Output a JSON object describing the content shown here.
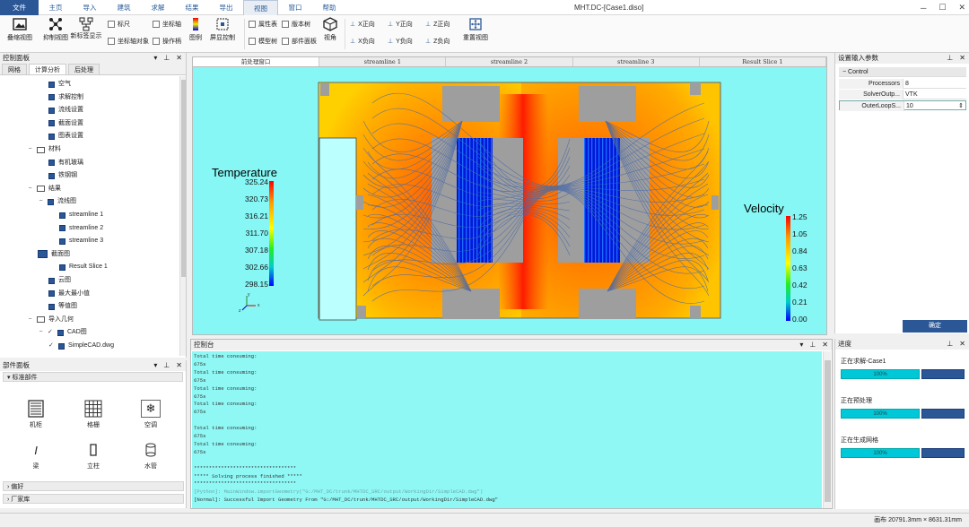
{
  "menu": {
    "items": [
      "文件",
      "主页",
      "导入",
      "建筑",
      "求解",
      "结果",
      "导出",
      "视图",
      "窗口",
      "帮助"
    ],
    "active_index": 7,
    "window_title": "MHT.DC-[Case1.diso]"
  },
  "toolbar": {
    "btn_overlay": "叠缩视图",
    "btn_shrink": "抑制视图",
    "btn_new_coord": "新标签显示",
    "chk_ruler": "标尺",
    "chk_coord_obj": "坐标轴对象",
    "chk_axis": "坐标轴",
    "chk_manipulator": "操作柄",
    "btn_legend": "图例",
    "btn_screen_ctrl": "屏显控制",
    "chk_props": "属性表",
    "chk_model_tree": "模型树",
    "chk_version_tree": "版本树",
    "chk_part_panel": "部件面板",
    "btn_view": "视角",
    "dir_xpos": "X正向",
    "dir_xneg": "X负向",
    "dir_ypos": "Y正向",
    "dir_yneg": "Y负向",
    "dir_zpos": "Z正向",
    "dir_zneg": "Z负向",
    "btn_reset": "重置视图"
  },
  "control_panel": {
    "title": "控制面板",
    "tabs": [
      "网格",
      "计算分析",
      "后处理"
    ],
    "active_tab": 1,
    "tree": [
      {
        "label": "空气",
        "level": 3,
        "icon": "box"
      },
      {
        "label": "求解控制",
        "level": 3,
        "icon": "box"
      },
      {
        "label": "流线设置",
        "level": 3,
        "icon": "box"
      },
      {
        "label": "截面设置",
        "level": 3,
        "icon": "box"
      },
      {
        "label": "图表设置",
        "level": 3,
        "icon": "box"
      },
      {
        "label": "材料",
        "level": 1,
        "icon": "folder"
      },
      {
        "label": "有机玻璃",
        "level": 3,
        "icon": "box"
      },
      {
        "label": "铁钢钢",
        "level": 3,
        "icon": "box"
      },
      {
        "label": "结果",
        "level": 1,
        "icon": "folder"
      },
      {
        "label": "流线图",
        "level": 2,
        "icon": "box"
      },
      {
        "label": "streamline 1",
        "level": 4,
        "icon": "box"
      },
      {
        "label": "streamline 2",
        "level": 4,
        "icon": "box"
      },
      {
        "label": "streamline 3",
        "level": 4,
        "icon": "box"
      },
      {
        "label": "截面图",
        "level": 2,
        "icon": "blue"
      },
      {
        "label": "Result Slice 1",
        "level": 4,
        "icon": "box"
      },
      {
        "label": "云图",
        "level": 3,
        "icon": "box"
      },
      {
        "label": "最大最小值",
        "level": 3,
        "icon": "box"
      },
      {
        "label": "等值图",
        "level": 3,
        "icon": "box"
      },
      {
        "label": "导入几何",
        "level": 1,
        "icon": "folder"
      },
      {
        "label": "CAD图",
        "level": 2,
        "icon": "check"
      },
      {
        "label": "SimpleCAD.dwg",
        "level": 3,
        "icon": "check"
      }
    ]
  },
  "parts_panel": {
    "title": "部件面板",
    "group": "标准部件",
    "items": [
      "机柜",
      "格栅",
      "空调",
      "梁",
      "立柱",
      "水管"
    ],
    "collapsed_groups": [
      "偏好",
      "厂家库"
    ]
  },
  "viewport": {
    "tabs": [
      "前处理窗口",
      "streamline 1",
      "streamline 2",
      "streamline 3",
      "Result Slice 1"
    ],
    "active_tab": 0,
    "temperature_legend": {
      "title": "Temperature",
      "ticks": [
        "325.24",
        "320.73",
        "316.21",
        "311.70",
        "307.18",
        "302.66",
        "298.15"
      ]
    },
    "velocity_legend": {
      "title": "Velocity",
      "ticks": [
        "1.25",
        "1.05",
        "0.84",
        "0.63",
        "0.42",
        "0.21",
        "0.00"
      ]
    },
    "axis_labels": {
      "x": "x",
      "y": "y",
      "z": "z"
    }
  },
  "console": {
    "title": "控制台",
    "lines": [
      {
        "text": "Total time consuming:",
        "type": "normal"
      },
      {
        "text": "675s",
        "type": "normal"
      },
      {
        "text": "Total time consuming:",
        "type": "normal"
      },
      {
        "text": "675s",
        "type": "normal"
      },
      {
        "text": "Total time consuming:",
        "type": "normal"
      },
      {
        "text": "675s",
        "type": "normal"
      },
      {
        "text": "Total time consuming:",
        "type": "normal"
      },
      {
        "text": "675s",
        "type": "normal"
      },
      {
        "text": "",
        "type": "normal"
      },
      {
        "text": "Total time consuming:",
        "type": "normal"
      },
      {
        "text": "675s",
        "type": "normal"
      },
      {
        "text": "Total time consuming:",
        "type": "normal"
      },
      {
        "text": "675s",
        "type": "normal"
      },
      {
        "text": "",
        "type": "normal"
      },
      {
        "text": "**********************************",
        "type": "normal"
      },
      {
        "text": "***** Solving process finished *****",
        "type": "normal"
      },
      {
        "text": "**********************************",
        "type": "normal"
      },
      {
        "text": "[Python]: MainWindow.importGeometry(\"G:/MHT_DC/trunk/MHTDC_SRC/output/WorkingDir/SimpleCAD.dwg\")",
        "type": "python"
      },
      {
        "text": "[Normal]: Successful Import Geometry From \"G:/MHT_DC/trunk/MHTDC_SRC/output/WorkingDir/SimpleCAD.dwg\"",
        "type": "normal"
      }
    ]
  },
  "settings_panel": {
    "title": "设置输入参数",
    "group": "Control",
    "props": [
      {
        "key": "Processors",
        "value": "8"
      },
      {
        "key": "SolverOutp...",
        "value": "VTK"
      },
      {
        "key": "OuterLoopS...",
        "value": "10"
      }
    ],
    "confirm": "确定"
  },
  "progress_panel": {
    "title": "进度",
    "tasks": [
      {
        "label": "正在求解-Case1",
        "percent": "100%",
        "value": 1.0
      },
      {
        "label": "正在预处理",
        "percent": "100%",
        "value": 1.0
      },
      {
        "label": "正在生成网格",
        "percent": "100%",
        "value": 1.0
      }
    ]
  },
  "status": {
    "text": "画布 20791.3mm × 8631.31mm"
  },
  "colors": {
    "accent": "#2b5797",
    "console_bg": "#8ff8f5",
    "viewport_bg": "#86f7f5",
    "progress": "#00c8d8"
  }
}
